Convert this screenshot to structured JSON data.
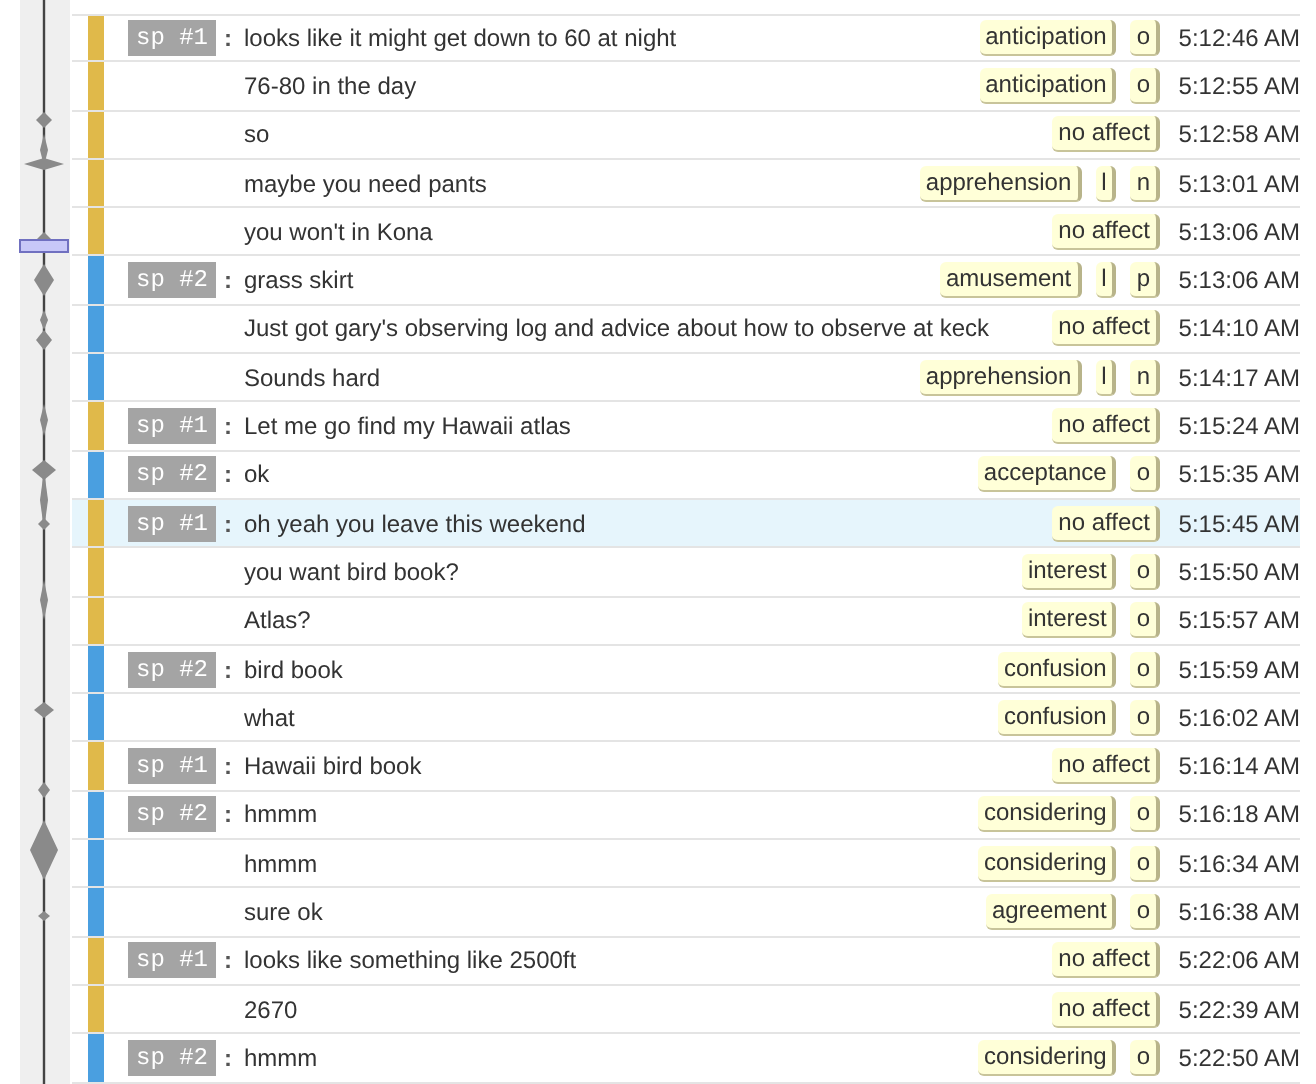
{
  "timeline": {
    "marker": true
  },
  "rows": [
    {
      "speaker": "sp #1",
      "separator": ":",
      "text": "looks like it might get down to 60 at night",
      "color": "#e0b94a",
      "tags": [
        "anticipation",
        "o"
      ],
      "time": "5:12:46 AM",
      "selected": false
    },
    {
      "text": "76-80 in the day",
      "color": "#e0b94a",
      "tags": [
        "anticipation",
        "o"
      ],
      "time": "5:12:55 AM",
      "selected": false
    },
    {
      "text": "so",
      "color": "#e0b94a",
      "tags": [
        "no affect"
      ],
      "time": "5:12:58 AM",
      "selected": false
    },
    {
      "text": "maybe you need pants",
      "color": "#e0b94a",
      "tags": [
        "apprehension",
        "l",
        "n"
      ],
      "time": "5:13:01 AM",
      "selected": false
    },
    {
      "text": "you won't in Kona",
      "color": "#e0b94a",
      "tags": [
        "no affect"
      ],
      "time": "5:13:06 AM",
      "selected": false
    },
    {
      "speaker": "sp #2",
      "separator": ":",
      "text": "grass skirt",
      "color": "#4a9fe0",
      "tags": [
        "amusement",
        "l",
        "p"
      ],
      "time": "5:13:06 AM",
      "selected": false
    },
    {
      "text": "Just got gary's observing log and advice about how to observe at keck",
      "color": "#4a9fe0",
      "tags": [
        "no affect"
      ],
      "time": "5:14:10 AM",
      "selected": false
    },
    {
      "text": "Sounds hard",
      "color": "#4a9fe0",
      "tags": [
        "apprehension",
        "l",
        "n"
      ],
      "time": "5:14:17 AM",
      "selected": false
    },
    {
      "speaker": "sp #1",
      "separator": ":",
      "text": "Let me go find my Hawaii atlas",
      "color": "#e0b94a",
      "tags": [
        "no affect"
      ],
      "time": "5:15:24 AM",
      "selected": false
    },
    {
      "speaker": "sp #2",
      "separator": ":",
      "text": "ok",
      "color": "#4a9fe0",
      "tags": [
        "acceptance",
        "o"
      ],
      "time": "5:15:35 AM",
      "selected": false
    },
    {
      "speaker": "sp #1",
      "separator": ":",
      "text": "oh yeah you leave this weekend",
      "color": "#e0b94a",
      "tags": [
        "no affect"
      ],
      "time": "5:15:45 AM",
      "selected": true
    },
    {
      "text": "you want bird book?",
      "color": "#e0b94a",
      "tags": [
        "interest",
        "o"
      ],
      "time": "5:15:50 AM",
      "selected": false
    },
    {
      "text": "Atlas?",
      "color": "#e0b94a",
      "tags": [
        "interest",
        "o"
      ],
      "time": "5:15:57 AM",
      "selected": false
    },
    {
      "speaker": "sp #2",
      "separator": ":",
      "text": "bird book",
      "color": "#4a9fe0",
      "tags": [
        "confusion",
        "o"
      ],
      "time": "5:15:59 AM",
      "selected": false
    },
    {
      "text": "what",
      "color": "#4a9fe0",
      "tags": [
        "confusion",
        "o"
      ],
      "time": "5:16:02 AM",
      "selected": false
    },
    {
      "speaker": "sp #1",
      "separator": ":",
      "text": "Hawaii bird book",
      "color": "#e0b94a",
      "tags": [
        "no affect"
      ],
      "time": "5:16:14 AM",
      "selected": false
    },
    {
      "speaker": "sp #2",
      "separator": ":",
      "text": "hmmm",
      "color": "#4a9fe0",
      "tags": [
        "considering",
        "o"
      ],
      "time": "5:16:18 AM",
      "selected": false
    },
    {
      "text": "hmmm",
      "color": "#4a9fe0",
      "tags": [
        "considering",
        "o"
      ],
      "time": "5:16:34 AM",
      "selected": false
    },
    {
      "text": "sure ok",
      "color": "#4a9fe0",
      "tags": [
        "agreement",
        "o"
      ],
      "time": "5:16:38 AM",
      "selected": false
    },
    {
      "speaker": "sp #1",
      "separator": ":",
      "text": "looks like something like 2500ft",
      "color": "#e0b94a",
      "tags": [
        "no affect"
      ],
      "time": "5:22:06 AM",
      "selected": false
    },
    {
      "text": "2670",
      "color": "#e0b94a",
      "tags": [
        "no affect"
      ],
      "time": "5:22:39 AM",
      "selected": false
    },
    {
      "speaker": "sp #2",
      "separator": ":",
      "text": "hmmm",
      "color": "#4a9fe0",
      "tags": [
        "considering",
        "o"
      ],
      "time": "5:22:50 AM",
      "selected": false
    }
  ]
}
